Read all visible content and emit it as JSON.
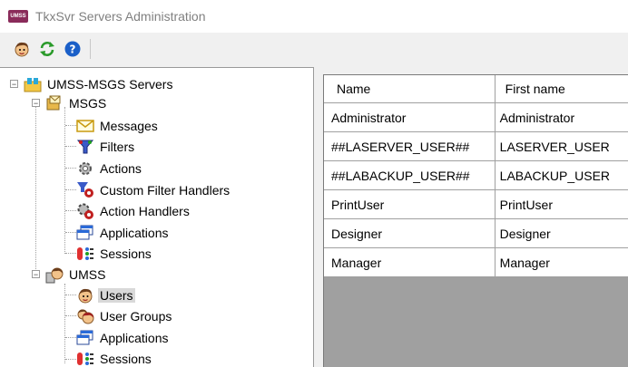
{
  "window": {
    "title": "TkxSvr Servers Administration",
    "app_icon_text": "UMSS"
  },
  "toolbar": {
    "buttons": [
      {
        "name": "user-wizard",
        "icon": "user-face-icon"
      },
      {
        "name": "refresh",
        "icon": "refresh-arrows-icon"
      },
      {
        "name": "help",
        "icon": "help-icon"
      }
    ]
  },
  "tree": {
    "root": "UMSS-MSGS Servers",
    "msgs": {
      "label": "MSGS",
      "children": [
        "Messages",
        "Filters",
        "Actions",
        "Custom Filter Handlers",
        "Action Handlers",
        "Applications",
        "Sessions"
      ]
    },
    "umss": {
      "label": "UMSS",
      "children": [
        "Users",
        "User Groups",
        "Applications",
        "Sessions"
      ]
    },
    "selected": "Users"
  },
  "grid": {
    "columns": [
      "Name",
      "First name"
    ],
    "rows": [
      [
        "Administrator",
        "Administrator"
      ],
      [
        "##LASERVER_USER##",
        "LASERVER_USER"
      ],
      [
        "##LABACKUP_USER##",
        "LABACKUP_USER"
      ],
      [
        "PrintUser",
        "PrintUser"
      ],
      [
        "Designer",
        "Designer"
      ],
      [
        "Manager",
        "Manager"
      ]
    ]
  },
  "colors": {
    "app_icon": "#8a2b5a",
    "selection": "#d9d9d9",
    "grid_empty": "#a0a0a0"
  }
}
